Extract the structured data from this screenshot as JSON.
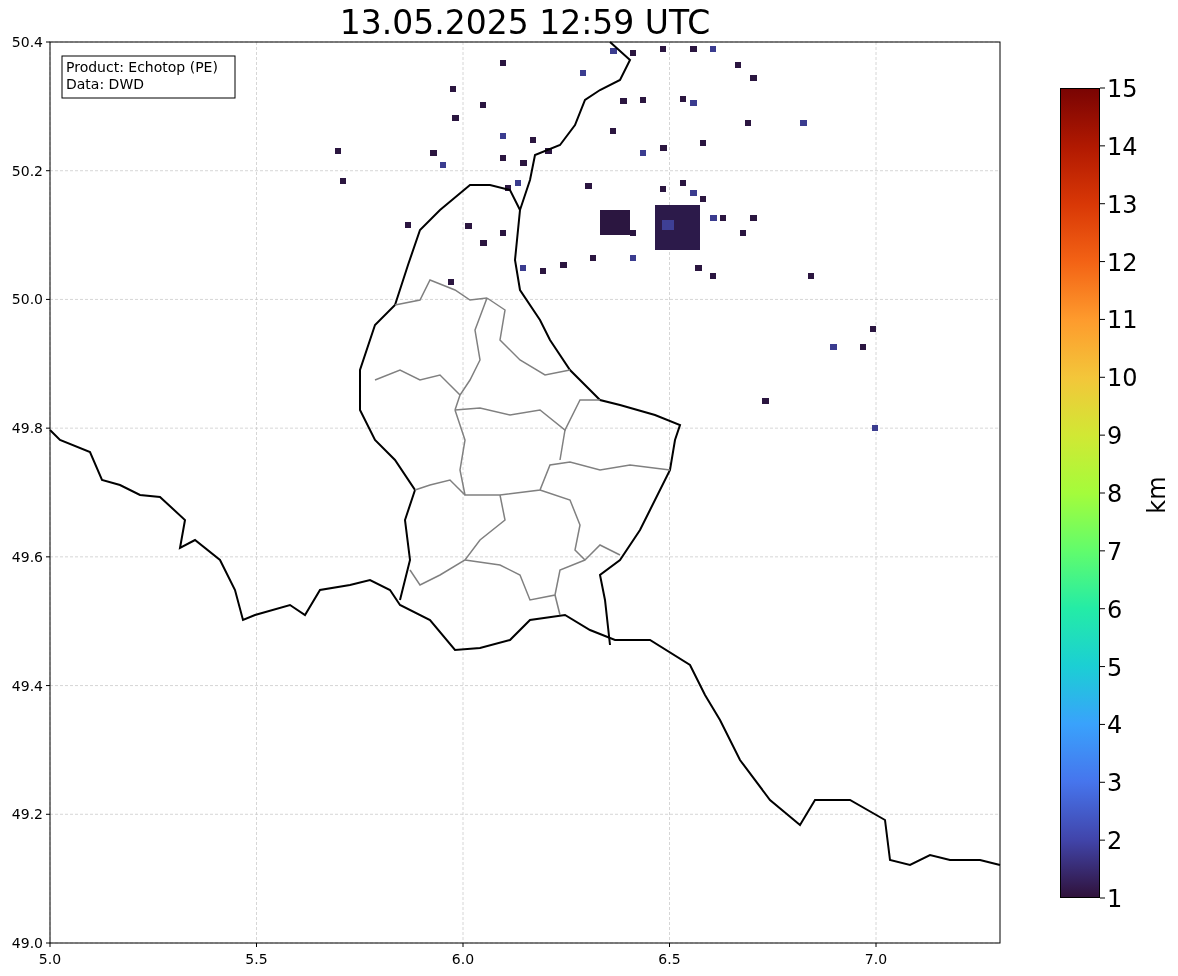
{
  "title": "13.05.2025 12:59 UTC",
  "map": {
    "info_box": [
      "Product: Echotop (PE)",
      "Data: DWD"
    ],
    "x_ticks": [
      "5.0",
      "5.5",
      "6.0",
      "6.5",
      "7.0"
    ],
    "y_ticks": [
      "50.4",
      "50.2",
      "50.0",
      "49.8",
      "49.6",
      "49.4",
      "49.2",
      "49.0"
    ]
  },
  "colorbar": {
    "label": "km",
    "ticks": [
      "15",
      "14",
      "13",
      "12",
      "11",
      "10",
      "9",
      "8",
      "7",
      "6",
      "5",
      "4",
      "3",
      "2",
      "1"
    ]
  }
}
